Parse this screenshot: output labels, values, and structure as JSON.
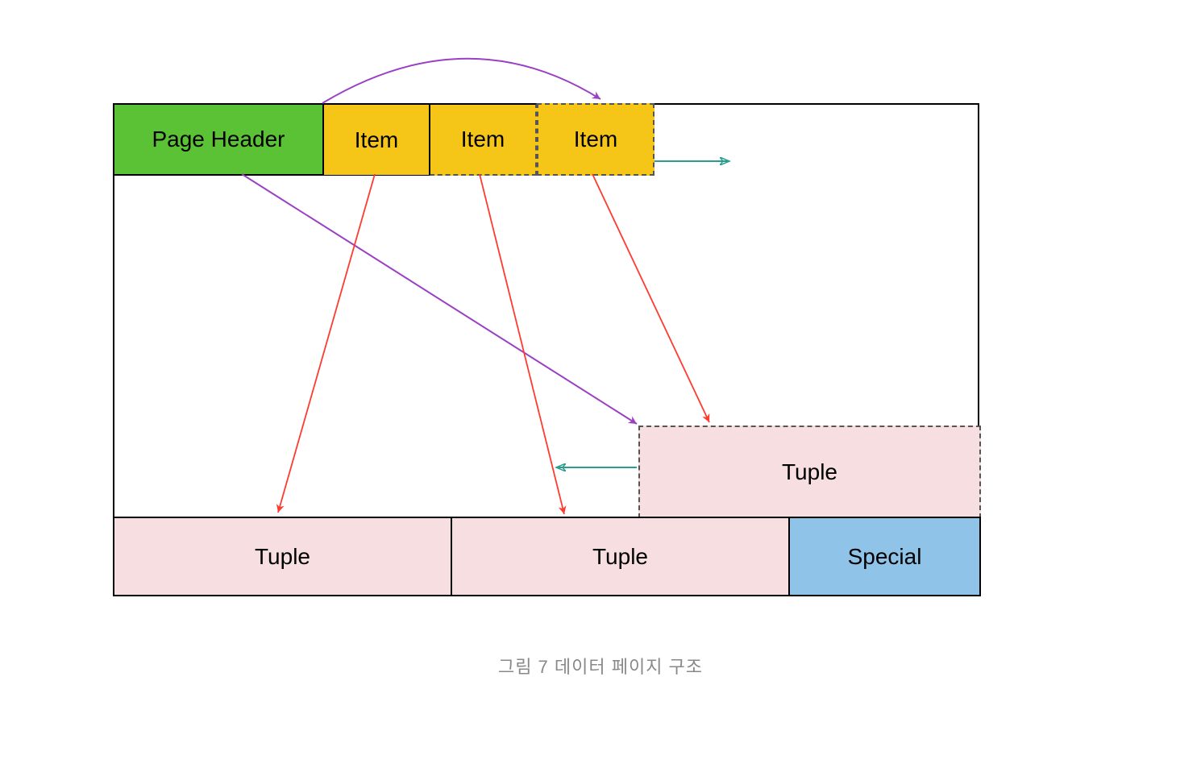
{
  "boxes": {
    "page_header": "Page Header",
    "item1": "Item",
    "item2": "Item",
    "item3": "Item",
    "tuple_top": "Tuple",
    "tuple_bl": "Tuple",
    "tuple_bm": "Tuple",
    "special": "Special"
  },
  "caption": "그림 7 데이터 페이지 구조",
  "colors": {
    "page_header": "#5bc236",
    "item": "#f5c518",
    "tuple": "#f7dfe1",
    "special": "#8fc4e8",
    "arrow_purple": "#9b3fc4",
    "arrow_red": "#ff3b30",
    "arrow_teal": "#2a9d8f"
  }
}
